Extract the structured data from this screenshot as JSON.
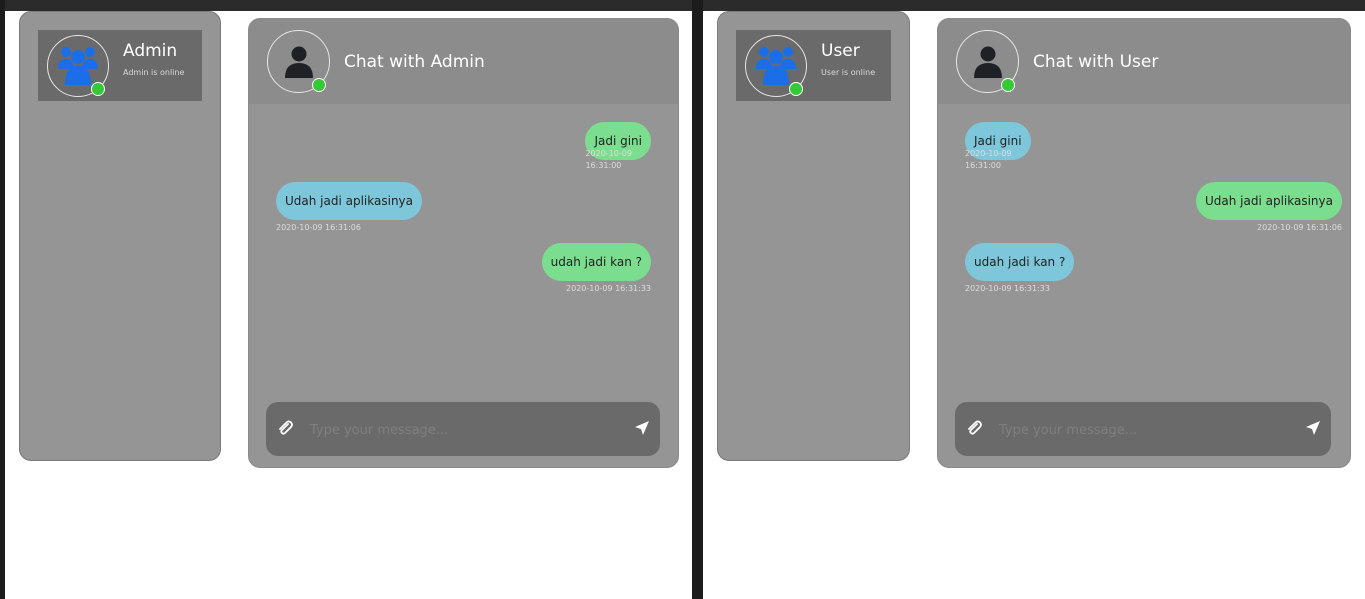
{
  "left": {
    "contact": {
      "name": "Admin",
      "status": "Admin is online"
    },
    "chat_title": "Chat with Admin",
    "messages": [
      {
        "text": "Jadi gini",
        "time": "2020-10-09 16:31:00",
        "direction": "out"
      },
      {
        "text": "Udah jadi aplikasinya",
        "time": "2020-10-09 16:31:06",
        "direction": "in"
      },
      {
        "text": "udah jadi kan ?",
        "time": "2020-10-09 16:31:33",
        "direction": "out"
      }
    ],
    "input_placeholder": "Type your message..."
  },
  "right": {
    "contact": {
      "name": "User",
      "status": "User is online"
    },
    "chat_title": "Chat with User",
    "messages": [
      {
        "text": "Jadi gini",
        "time": "2020-10-09 16:31:00",
        "direction": "in"
      },
      {
        "text": "Udah jadi aplikasinya",
        "time": "2020-10-09 16:31:06",
        "direction": "out"
      },
      {
        "text": "udah jadi kan ?",
        "time": "2020-10-09 16:31:33",
        "direction": "in"
      }
    ],
    "input_placeholder": "Type your message..."
  },
  "icons": {
    "contact_avatar": "group-users-icon",
    "chat_avatar": "user-icon",
    "attach": "paperclip-icon",
    "send": "send-arrow-icon"
  },
  "colors": {
    "outgoing_bubble": "#7bde8e",
    "incoming_bubble": "#7ec7db",
    "online": "#37c837",
    "contact_avatar": "#1a6fe8"
  }
}
